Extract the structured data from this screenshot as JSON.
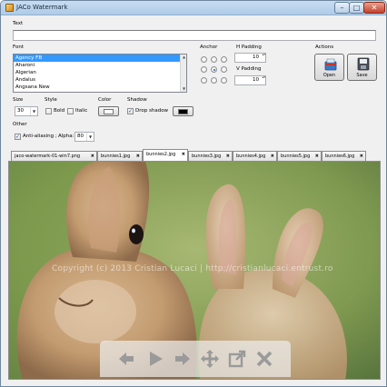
{
  "window": {
    "title": "JACo Watermark"
  },
  "text_section": {
    "label": "Text",
    "value": ""
  },
  "font_section": {
    "label": "Font",
    "fonts": [
      "Agency FB",
      "Aharoni",
      "Algerian",
      "Andalus",
      "Angsana New"
    ],
    "selected_index": 0
  },
  "anchor": {
    "label": "Anchor",
    "selected": "middle-center"
  },
  "padding": {
    "h_label": "H Padding",
    "h_value": "10",
    "v_label": "V Padding",
    "v_value": "10"
  },
  "actions": {
    "label": "Actions",
    "open_label": "Open",
    "save_label": "Save"
  },
  "size": {
    "label": "Size",
    "value": "30"
  },
  "style": {
    "label": "Style",
    "bold_label": "Bold",
    "italic_label": "Italic"
  },
  "color": {
    "label": "Color",
    "value": "#ffffff"
  },
  "shadow": {
    "label": "Shadow",
    "checkbox_label": "Drop shadow",
    "color": "#000000"
  },
  "other": {
    "label": "Other",
    "antialias_label": "Anti-aliasing ;",
    "alpha_label": "Alpha:",
    "alpha_value": "80"
  },
  "tabs": [
    {
      "label": "jaco-watermark-01-win7.png"
    },
    {
      "label": "bunnies1.jpg"
    },
    {
      "label": "bunnies2.jpg"
    },
    {
      "label": "bunnies3.jpg"
    },
    {
      "label": "bunnies4.jpg"
    },
    {
      "label": "bunnies5.jpg"
    },
    {
      "label": "bunnies6.jpg"
    }
  ],
  "active_tab": 2,
  "preview": {
    "watermark_text": "Copyright (c) 2013 Cristian Lucaci | http://cristianlucaci.entrust.ro"
  },
  "overlay_toolbar": {
    "buttons": [
      "arrow-left-icon",
      "play-icon",
      "arrow-right-icon",
      "move-icon",
      "popout-icon",
      "close-icon"
    ]
  },
  "colors": {
    "accent": "#3399ff",
    "titlebar": "#b7d0ea"
  }
}
